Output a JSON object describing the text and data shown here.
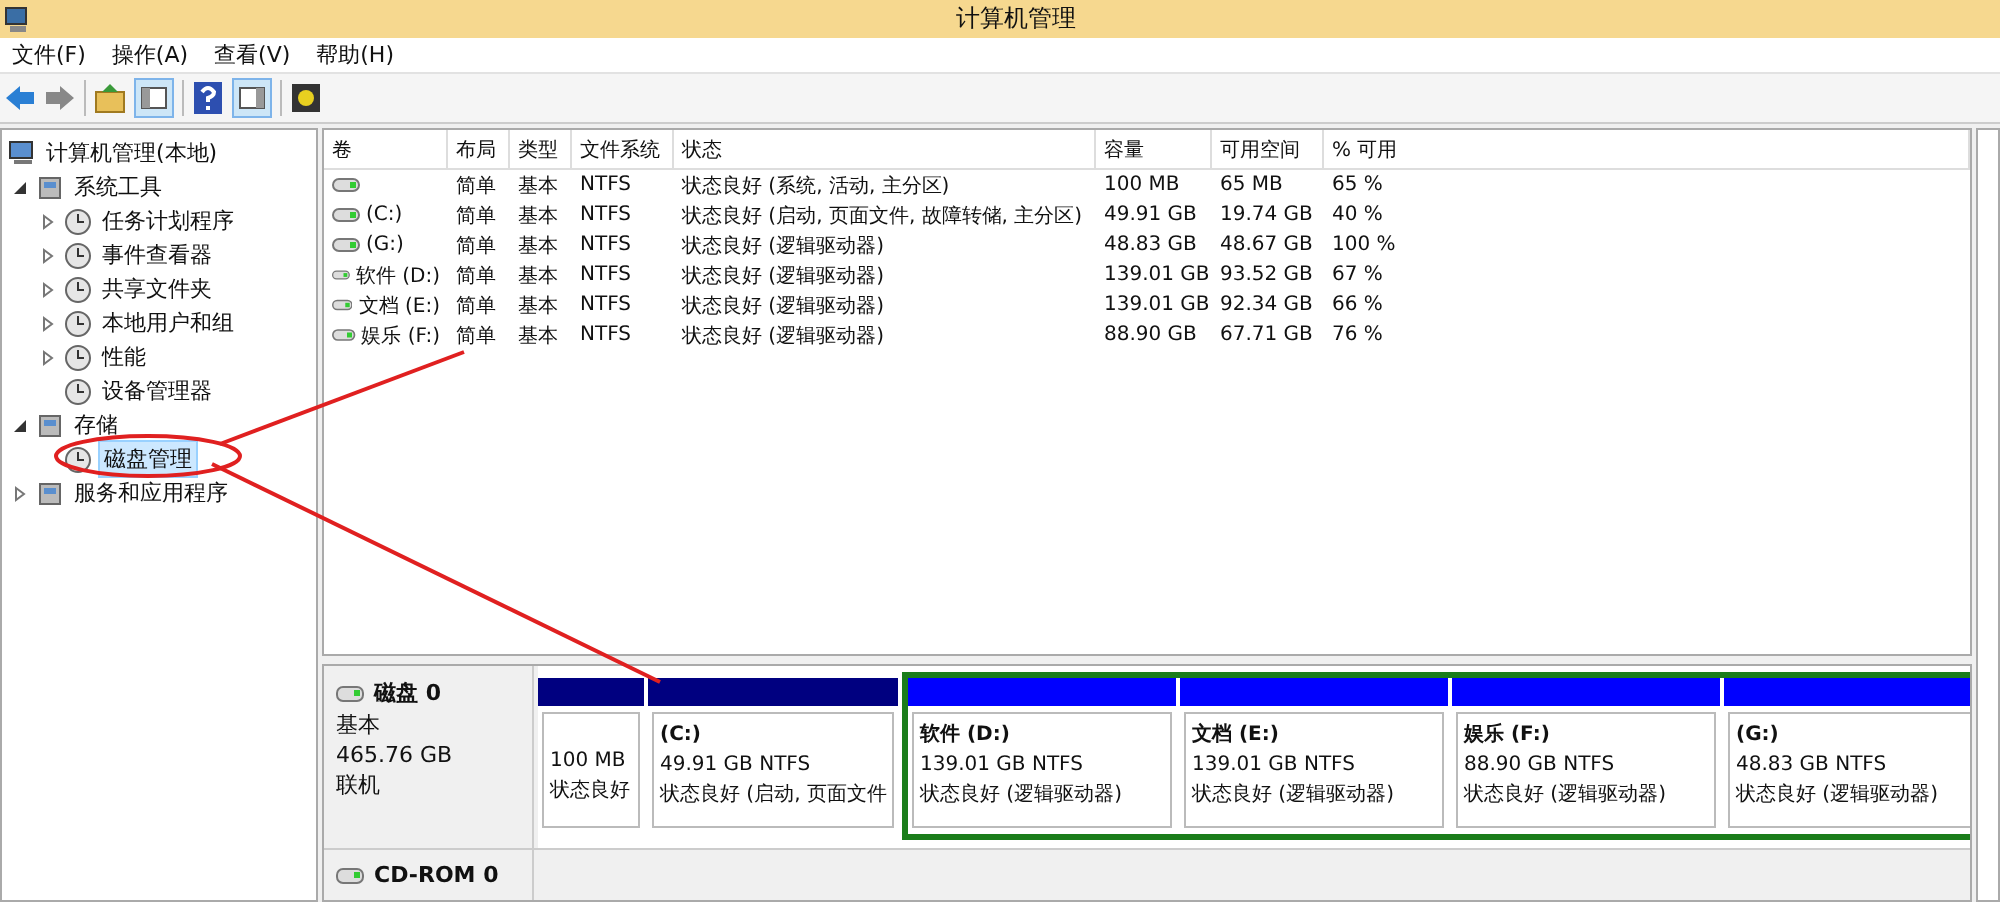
{
  "window": {
    "title": "计算机管理"
  },
  "menu": [
    "文件(F)",
    "操作(A)",
    "查看(V)",
    "帮助(H)"
  ],
  "tree": [
    {
      "label": "计算机管理(本地)",
      "selected": false,
      "children": [
        {
          "label": "系统工具",
          "expanded": true,
          "selected": false,
          "children": [
            {
              "label": "任务计划程序",
              "expanded": false,
              "selected": false
            },
            {
              "label": "事件查看器",
              "expanded": false,
              "selected": false
            },
            {
              "label": "共享文件夹",
              "expanded": false,
              "selected": false
            },
            {
              "label": "本地用户和组",
              "expanded": false,
              "selected": false
            },
            {
              "label": "性能",
              "expanded": false,
              "selected": false
            },
            {
              "label": "设备管理器",
              "selected": false
            }
          ]
        },
        {
          "label": "存储",
          "expanded": true,
          "selected": false,
          "children": [
            {
              "label": "磁盘管理",
              "selected": true
            }
          ]
        },
        {
          "label": "服务和应用程序",
          "expanded": false,
          "selected": false
        }
      ]
    }
  ],
  "table": {
    "columns": [
      "卷",
      "布局",
      "类型",
      "文件系统",
      "状态",
      "容量",
      "可用空间",
      "% 可用"
    ],
    "rows": [
      [
        "",
        "简单",
        "基本",
        "NTFS",
        "状态良好 (系统, 活动, 主分区)",
        "100 MB",
        "65 MB",
        "65 %"
      ],
      [
        "(C:)",
        "简单",
        "基本",
        "NTFS",
        "状态良好 (启动, 页面文件, 故障转储, 主分区)",
        "49.91 GB",
        "19.74 GB",
        "40 %"
      ],
      [
        "(G:)",
        "简单",
        "基本",
        "NTFS",
        "状态良好 (逻辑驱动器)",
        "48.83 GB",
        "48.67 GB",
        "100 %"
      ],
      [
        "软件 (D:)",
        "简单",
        "基本",
        "NTFS",
        "状态良好 (逻辑驱动器)",
        "139.01 GB",
        "93.52 GB",
        "67 %"
      ],
      [
        "文档 (E:)",
        "简单",
        "基本",
        "NTFS",
        "状态良好 (逻辑驱动器)",
        "139.01 GB",
        "92.34 GB",
        "66 %"
      ],
      [
        "娱乐 (F:)",
        "简单",
        "基本",
        "NTFS",
        "状态良好 (逻辑驱动器)",
        "88.90 GB",
        "67.71 GB",
        "76 %"
      ]
    ]
  },
  "disks": [
    {
      "name": "磁盘 0",
      "lines": [
        "基本",
        "465.76 GB",
        "联机"
      ],
      "partitions": [
        {
          "kind": "primary",
          "size": "100 MB",
          "status": "状态良好"
        },
        {
          "kind": "primary",
          "name": "(C:)",
          "size": "49.91 GB NTFS",
          "status": "状态良好 (启动, 页面文件"
        },
        {
          "kind": "logical",
          "name": "软件  (D:)",
          "size": "139.01 GB NTFS",
          "status": "状态良好 (逻辑驱动器)"
        },
        {
          "kind": "logical",
          "name": "文档  (E:)",
          "size": "139.01 GB NTFS",
          "status": "状态良好 (逻辑驱动器)"
        },
        {
          "kind": "logical",
          "name": "娱乐  (F:)",
          "size": "88.90 GB NTFS",
          "status": "状态良好 (逻辑驱动器)"
        },
        {
          "kind": "logical",
          "name": "(G:)",
          "size": "48.83 GB NTFS",
          "status": "状态良好 (逻辑驱动器)"
        }
      ]
    },
    {
      "name": "CD-ROM 0"
    }
  ]
}
